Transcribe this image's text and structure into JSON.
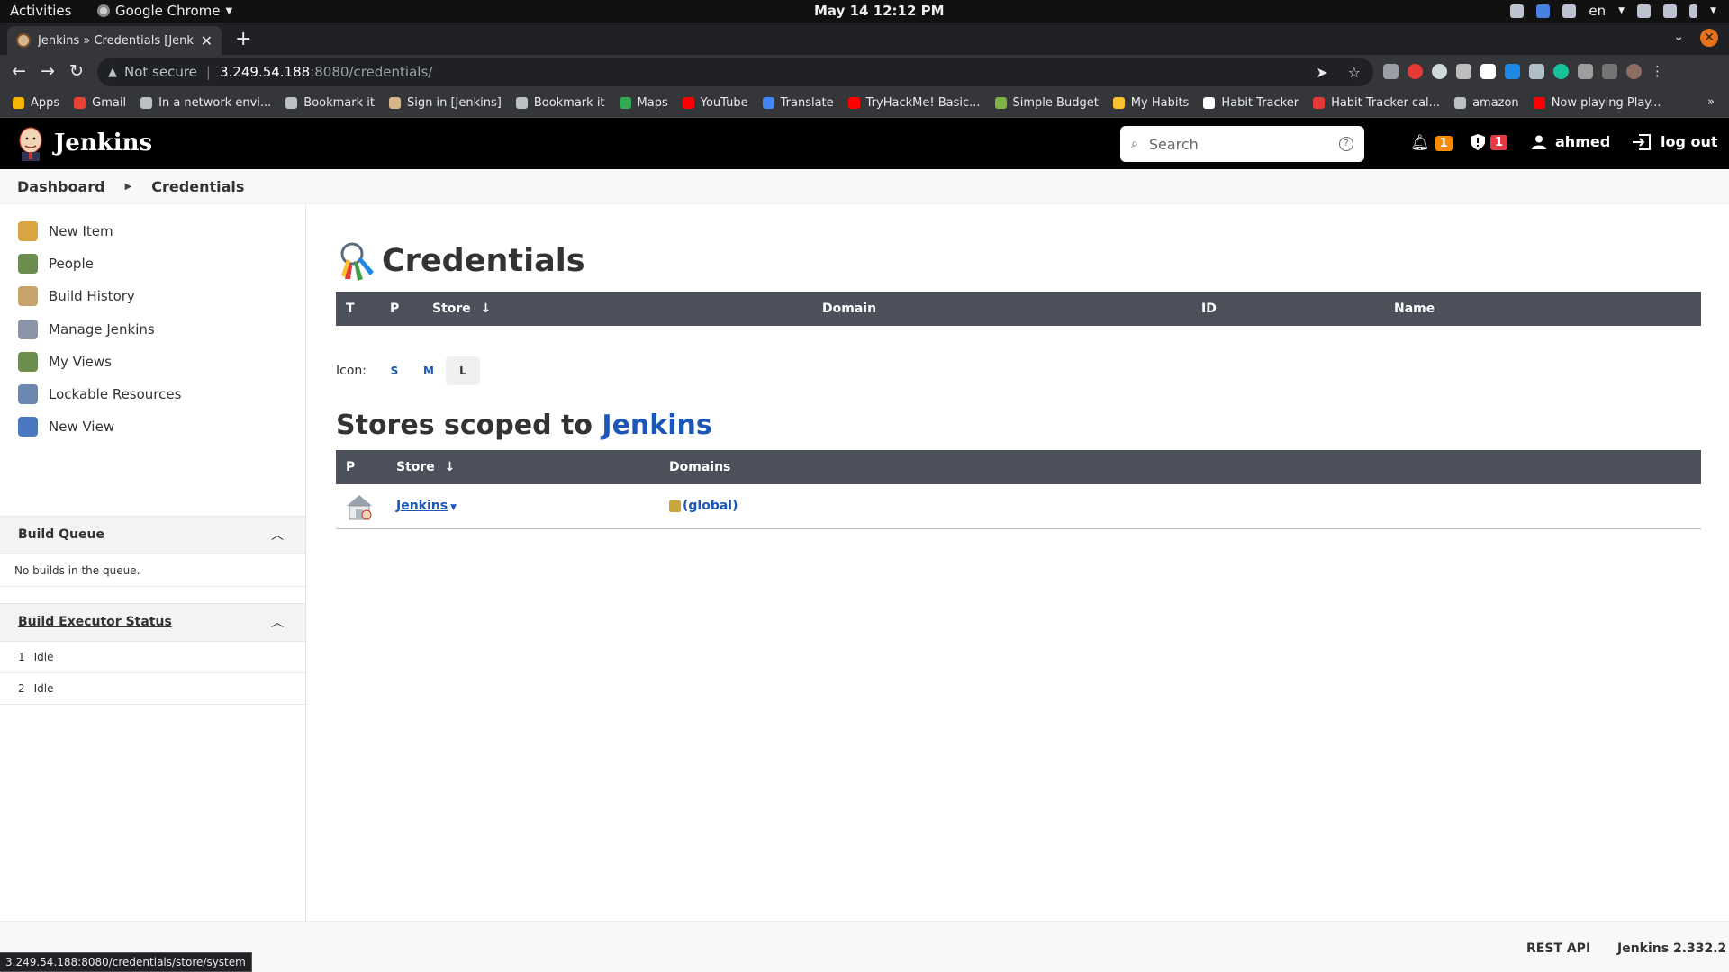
{
  "os": {
    "activities": "Activities",
    "app": "Google Chrome",
    "clock": "May 14  12:12 PM",
    "lang": "en"
  },
  "browser": {
    "tab_title": "Jenkins » Credentials [Jenkins",
    "address": {
      "warning": "Not secure",
      "host": "3.249.54.188",
      "path": ":8080/credentials/"
    },
    "bookmarks": [
      {
        "label": "Apps",
        "icon": "apps-grid-icon",
        "color": "#f4b400"
      },
      {
        "label": "Gmail",
        "icon": "gmail-icon",
        "color": "#ea4335"
      },
      {
        "label": "In a network envi...",
        "icon": "globe-icon",
        "color": "#bdc1c6"
      },
      {
        "label": "Bookmark it",
        "icon": "globe-icon",
        "color": "#bdc1c6"
      },
      {
        "label": "Sign in [Jenkins]",
        "icon": "jenkins-icon",
        "color": "#d7b58a"
      },
      {
        "label": "Bookmark it",
        "icon": "globe-icon",
        "color": "#bdc1c6"
      },
      {
        "label": "Maps",
        "icon": "maps-icon",
        "color": "#34a853"
      },
      {
        "label": "YouTube",
        "icon": "youtube-icon",
        "color": "#ff0000"
      },
      {
        "label": "Translate",
        "icon": "translate-icon",
        "color": "#4285f4"
      },
      {
        "label": "TryHackMe! Basic...",
        "icon": "youtube-icon",
        "color": "#ff0000"
      },
      {
        "label": "Simple Budget",
        "icon": "budget-icon",
        "color": "#7cb342"
      },
      {
        "label": "My Habits",
        "icon": "habits-icon",
        "color": "#fbc02d"
      },
      {
        "label": "Habit Tracker",
        "icon": "notion-icon",
        "color": "#ffffff"
      },
      {
        "label": "Habit Tracker cal...",
        "icon": "tracker-icon",
        "color": "#e53935"
      },
      {
        "label": "amazon",
        "icon": "folder-icon",
        "color": "#bdc1c6"
      },
      {
        "label": "Now playing Play...",
        "icon": "youtube-icon",
        "color": "#ff0000"
      }
    ]
  },
  "jenkins": {
    "brand": "Jenkins",
    "search_placeholder": "Search",
    "notifications_count": "1",
    "security_count": "1",
    "user": "ahmed",
    "logout": "log out",
    "breadcrumbs": [
      "Dashboard",
      "Credentials"
    ],
    "tasks": [
      {
        "label": "New Item",
        "icon": "new-item-icon",
        "color": "#d9a441"
      },
      {
        "label": "People",
        "icon": "people-icon",
        "color": "#6b8e4e"
      },
      {
        "label": "Build History",
        "icon": "build-history-icon",
        "color": "#c8a26a"
      },
      {
        "label": "Manage Jenkins",
        "icon": "gear-icon",
        "color": "#8a94a6"
      },
      {
        "label": "My Views",
        "icon": "my-views-icon",
        "color": "#6b8e4e"
      },
      {
        "label": "Lockable Resources",
        "icon": "lockable-resources-icon",
        "color": "#6a88b0"
      },
      {
        "label": "New View",
        "icon": "folder-icon",
        "color": "#4a78c2"
      }
    ],
    "build_queue": {
      "title": "Build Queue",
      "empty": "No builds in the queue."
    },
    "executors": {
      "title": "Build Executor Status",
      "rows": [
        {
          "num": "1",
          "status": "Idle"
        },
        {
          "num": "2",
          "status": "Idle"
        }
      ]
    },
    "page_title": "Credentials",
    "credentials_table": {
      "headers": [
        "T",
        "P",
        "Store",
        "Domain",
        "ID",
        "Name"
      ],
      "sort_arrow": "↓"
    },
    "icon_size": {
      "label": "Icon:",
      "options": [
        "S",
        "M",
        "L"
      ],
      "selected": "L"
    },
    "stores_title": {
      "prefix": "Stores scoped to",
      "link": "Jenkins"
    },
    "stores_table": {
      "headers": [
        "P",
        "Store",
        "Domains"
      ],
      "rows": [
        {
          "store": "Jenkins",
          "domain": "(global)"
        }
      ]
    },
    "footer": {
      "rest_api": "REST API",
      "version": "Jenkins 2.332.2"
    },
    "status_url": "3.249.54.188:8080/credentials/store/system"
  },
  "colors": {
    "link": "#1b56b8",
    "table_header": "#4c505a",
    "notif_badge": "#fb8c00",
    "security_badge": "#e63946"
  }
}
